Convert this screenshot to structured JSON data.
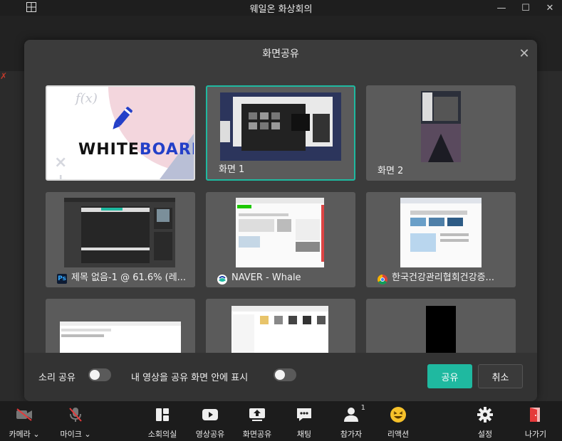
{
  "window": {
    "title": "웨일온 화상회의",
    "controls": [
      "minimize",
      "maximize",
      "close"
    ]
  },
  "modal": {
    "title": "화면공유",
    "tiles": [
      {
        "label": "",
        "kind": "whiteboard",
        "wordmark_a": "WHITE",
        "wordmark_b": "BOARD",
        "formula": "f(x)"
      },
      {
        "label": "화면 1",
        "kind": "screen",
        "selected": true
      },
      {
        "label": "화면 2",
        "kind": "screen"
      },
      {
        "label": "제목 없음-1 @ 61.6% (레...",
        "kind": "app",
        "icon": "photoshop-icon",
        "icon_text": "Ps"
      },
      {
        "label": "NAVER - Whale",
        "kind": "app",
        "icon": "whale-icon"
      },
      {
        "label": "한국건강관리협회건강증...",
        "kind": "app",
        "icon": "chrome-icon"
      },
      {
        "label": "",
        "kind": "app"
      },
      {
        "label": "",
        "kind": "app"
      },
      {
        "label": "",
        "kind": "app"
      }
    ],
    "footer": {
      "sound_share_label": "소리 공유",
      "show_video_label": "내 영상을 공유 화면 안에 표시",
      "share_button": "공유",
      "cancel_button": "취소"
    }
  },
  "toolbar": {
    "camera": "카메라",
    "mic": "마이크",
    "breakout": "소회의실",
    "video_share": "영상공유",
    "screen_share": "화면공유",
    "chat": "채팅",
    "participants": "참가자",
    "participants_count": "1",
    "reaction": "리액션",
    "settings": "설정",
    "leave": "나가기"
  },
  "colors": {
    "accent": "#1fb9a0",
    "leave": "#e5393a"
  }
}
